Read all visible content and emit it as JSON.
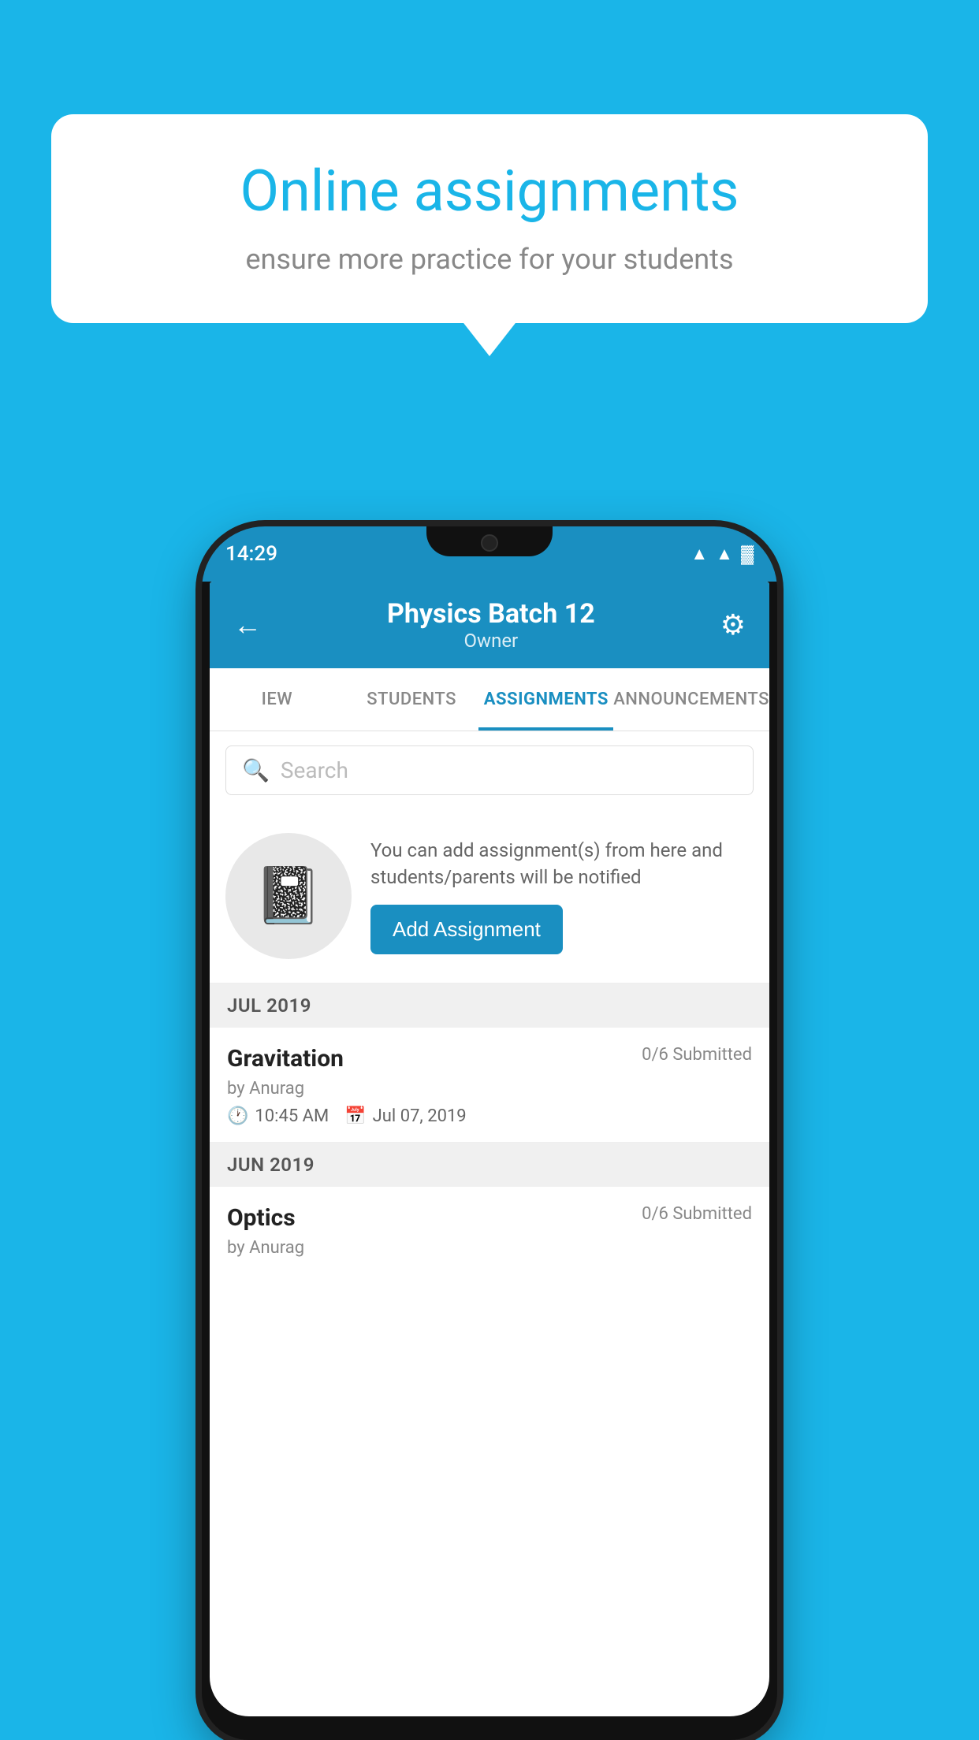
{
  "background": {
    "color": "#1ab5e8"
  },
  "speech_bubble": {
    "title": "Online assignments",
    "subtitle": "ensure more practice for your students"
  },
  "phone": {
    "status_bar": {
      "time": "14:29"
    },
    "header": {
      "title": "Physics Batch 12",
      "subtitle": "Owner",
      "back_label": "←",
      "settings_label": "⚙"
    },
    "tabs": [
      {
        "label": "IEW",
        "active": false
      },
      {
        "label": "STUDENTS",
        "active": false
      },
      {
        "label": "ASSIGNMENTS",
        "active": true
      },
      {
        "label": "ANNOUNCEMENTS",
        "active": false
      }
    ],
    "search": {
      "placeholder": "Search"
    },
    "add_assignment": {
      "description": "You can add assignment(s) from here and students/parents will be notified",
      "button_label": "Add Assignment"
    },
    "sections": [
      {
        "header": "JUL 2019",
        "items": [
          {
            "name": "Gravitation",
            "submitted": "0/6 Submitted",
            "by": "by Anurag",
            "time": "10:45 AM",
            "date": "Jul 07, 2019"
          }
        ]
      },
      {
        "header": "JUN 2019",
        "items": [
          {
            "name": "Optics",
            "submitted": "0/6 Submitted",
            "by": "by Anurag",
            "time": "",
            "date": ""
          }
        ]
      }
    ]
  }
}
